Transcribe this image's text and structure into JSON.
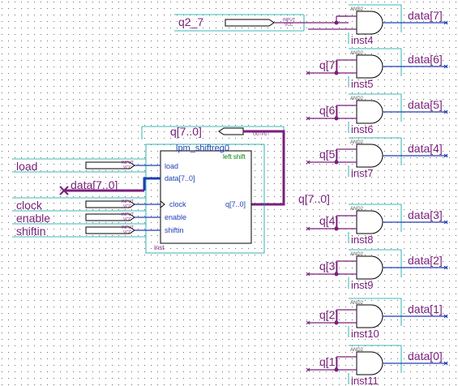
{
  "inputs": {
    "q2_7": "q2_7",
    "load": "load",
    "data_bus": "data[7..0]",
    "clock": "clock",
    "enable": "enable",
    "shiftin": "shiftin",
    "pin_type": "INPUT",
    "pin_vcc": "VCC"
  },
  "output_pin": {
    "label": "q[7..0]",
    "type": "OUTPUT"
  },
  "shiftreg": {
    "title": "lpm_shiftreg0",
    "mode": "left shift",
    "ports": [
      "load",
      "data[7..0]",
      "clock",
      "enable",
      "shiftin"
    ],
    "out_port": "q[7..0]",
    "inst": "inst"
  },
  "bus_label": "q[7..0]",
  "gate_type": "AND2",
  "gates": [
    {
      "in": "q2_7",
      "out": "data[7]",
      "inst": "inst4"
    },
    {
      "in": "q[7]",
      "out": "data[6]",
      "inst": "inst5"
    },
    {
      "in": "q[6]",
      "out": "data[5]",
      "inst": "inst6"
    },
    {
      "in": "q[5]",
      "out": "data[4]",
      "inst": "inst7"
    },
    {
      "in": "q[4]",
      "out": "data[3]",
      "inst": "inst8"
    },
    {
      "in": "q[3]",
      "out": "data[2]",
      "inst": "inst9"
    },
    {
      "in": "q[2]",
      "out": "data[1]",
      "inst": "inst10"
    },
    {
      "in": "q[1]",
      "out": "data[0]",
      "inst": "inst11"
    }
  ]
}
